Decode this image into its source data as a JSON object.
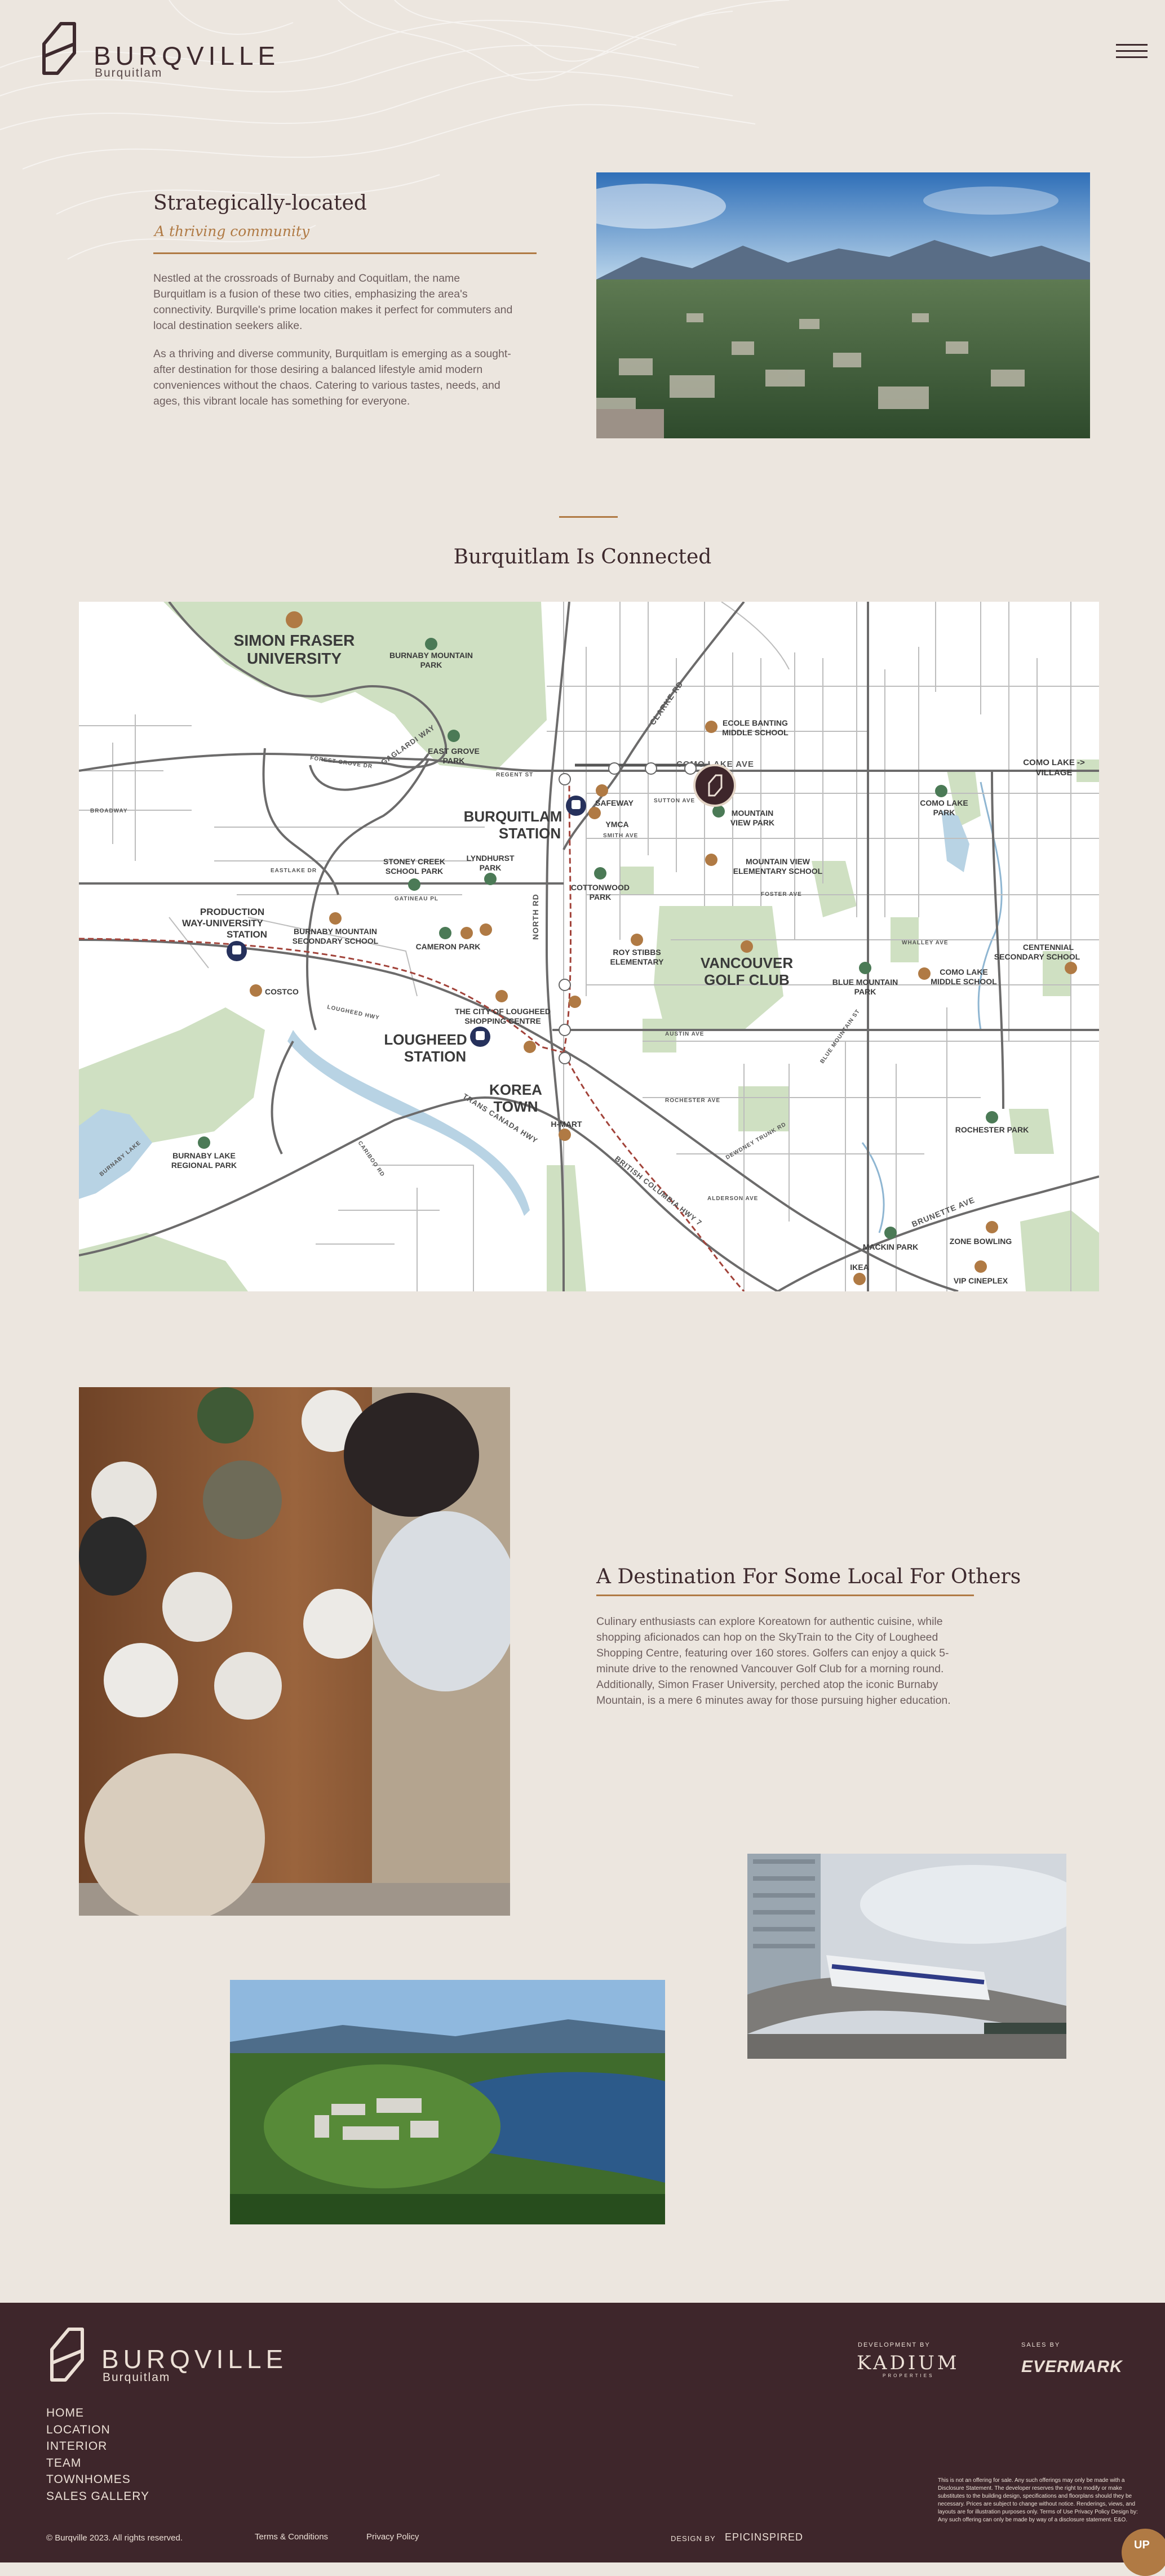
{
  "header": {
    "brand": "BURQVILLE",
    "sub": "Burquitlam",
    "menu_icon": "hamburger-menu-icon"
  },
  "intro": {
    "title": "Strategically-located",
    "subtitle": "A thriving community",
    "p1": "Nestled at the crossroads of Burnaby and Coquitlam, the name Burquitlam is a fusion of these two cities, emphasizing the area's connectivity. Burqville's prime location makes it perfect for commuters and local destination seekers alike.",
    "p2": "As a thriving and diverse community, Burquitlam is emerging as a sought-after destination for those desiring a balanced lifestyle amid modern conveniences without the chaos. Catering to various tastes, needs, and ages, this vibrant locale has something for everyone."
  },
  "connected": {
    "title": "Burquitlam Is Connected"
  },
  "map": {
    "colors": {
      "park": "#cfe0c2",
      "road": "#6c6b6b",
      "water": "#b8d3e4",
      "brown": "#b07a44",
      "navy": "#26315c",
      "green": "#4b7a56"
    },
    "labels": {
      "sfu": [
        "SIMON FRASER",
        "UNIVERSITY"
      ],
      "burnaby_mtn_park": [
        "BURNABY MOUNTAIN",
        "PARK"
      ],
      "ecole": [
        "ECOLE BANTING",
        "MIDDLE SCHOOL"
      ],
      "como_lake_ave": "COMO LAKE AVE",
      "como_lake_village": [
        "COMO LAKE ->",
        "VILLAGE"
      ],
      "east_grove": [
        "EAST GROVE",
        "PARK"
      ],
      "safeway": "SAFEWAY",
      "ymca": "YMCA",
      "mountain_view_park": [
        "MOUNTAIN",
        "VIEW PARK"
      ],
      "como_lake_park": [
        "COMO LAKE",
        "PARK"
      ],
      "burquitlam_station": [
        "BURQUITLAM",
        "STATION"
      ],
      "stoney_creek": [
        "STONEY CREEK",
        "SCHOOL PARK"
      ],
      "lyndhurst": [
        "LYNDHURST",
        "PARK"
      ],
      "mountain_view_elem": [
        "MOUNTAIN VIEW",
        "ELEMENTARY SCHOOL"
      ],
      "cottonwood": [
        "COTTONWOOD",
        "PARK"
      ],
      "production_way": [
        "PRODUCTION",
        "WAY-UNIVERSITY",
        "STATION"
      ],
      "burnaby_mtn_school": [
        "BURNABY MOUNTAIN",
        "SECONDARY SCHOOL"
      ],
      "cameron_park": "CAMERON PARK",
      "roy_stibbs": [
        "ROY STIBBS",
        "ELEMENTARY"
      ],
      "vancouver_golf": [
        "VANCOUVER",
        "GOLF CLUB"
      ],
      "blue_mountain": [
        "BLUE MOUNTAIN",
        "PARK"
      ],
      "como_lake_middle": [
        "COMO LAKE",
        "MIDDLE SCHOOL"
      ],
      "centennial": [
        "CENTENNIAL",
        "SECONDARY SCHOOL"
      ],
      "costco": "COSTCO",
      "lougheed_centre": [
        "THE CITY OF LOUGHEED",
        "SHOPPING CENTRE"
      ],
      "lougheed_station": [
        "LOUGHEED",
        "STATION"
      ],
      "korea_town": [
        "KOREA",
        "TOWN"
      ],
      "h_mart": "H-MART",
      "burnaby_lake": [
        "BURNABY LAKE",
        "REGIONAL PARK"
      ],
      "rochester": "ROCHESTER PARK",
      "mackin": "MACKIN PARK",
      "zone_bowling": "ZONE BOWLING",
      "ikea": "IKEA",
      "vip_cineplex": "VIP CINEPLEX",
      "gaglardi": "GAGLARDI WAY",
      "north_rd": "NORTH RD",
      "clarke_rd": "CLARKE RD",
      "tch": "TRANS CANADA HWY",
      "bc_hwy": "BRITISH COLUMBIA HWY 7",
      "brunette": "BRUNETTE AVE",
      "cariboo": "CARIBOO RD",
      "lougheed_hwy": "LOUGHEED HWY",
      "broadway": "BROADWAY",
      "austin": "AUSTIN AVE",
      "rochester_ave": "ROCHESTER AVE",
      "foster": "FOSTER AVE",
      "whalley": "WHALLEY AVE",
      "eastlake": "EASTLAKE DR",
      "burnaby_lake_label": "BURNABY LAKE",
      "forest_grove": "FOREST GROVE DR",
      "smith": "SMITH AVE",
      "sutton": "SUTTON AVE",
      "regent": "REGENT ST",
      "dewdney": "DEWDNEY TRUNK RD",
      "gatineau": "GATINEAU PL",
      "alderson": "ALDERSON AVE",
      "blue_mtn_st": "BLUE MOUNTAIN ST"
    }
  },
  "destination": {
    "title": "A Destination For Some Local For Others",
    "p": "Culinary enthusiasts can explore Koreatown for authentic cuisine, while shopping aficionados can hop on the SkyTrain to the City of Lougheed Shopping Centre, featuring over 160 stores. Golfers can enjoy a quick 5-minute drive to the renowned Vancouver Golf Club for a morning round. Additionally, Simon Fraser University, perched atop the iconic Burnaby Mountain, is a mere 6 minutes away for those pursuing higher education."
  },
  "footer": {
    "brand": "BURQVILLE",
    "sub": "Burquitlam",
    "nav": [
      "HOME",
      "LOCATION",
      "INTERIOR",
      "TEAM",
      "TOWNHOMES",
      "SALES GALLERY"
    ],
    "copyright": "© Burqville 2023. All rights reserved.",
    "terms": "Terms & Conditions",
    "privacy": "Privacy Policy",
    "dev_label": "DEVELOPMENT BY",
    "kadium": "KADIUM",
    "kadium_sub": "PROPERTIES",
    "sales_label": "SALES BY",
    "evermark": "EVERMARK",
    "disclaimer": "This is not an offering for sale. Any such offerings may only be made with a Disclosure Statement. The developer reserves the right to modify or make substitutes to the building design, specifications and floorplans should they be necessary. Prices are subject to change without notice. Renderings, views, and layouts are for illustration purposes only. Terms of Use Privacy Policy Design by: Any such offering can only be made by way of a disclosure statement. E&O.",
    "design_by": "DESIGN BY",
    "epic": "EPICINSPIRED",
    "up": "UP"
  }
}
